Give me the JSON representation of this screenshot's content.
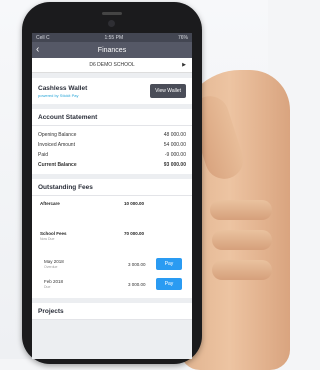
{
  "status_bar": {
    "carrier": "Cell C",
    "time": "1:55 PM",
    "battery": "76%"
  },
  "nav": {
    "title": "Finances"
  },
  "school": {
    "name": "D6 DEMO SCHOOL"
  },
  "wallet": {
    "title": "Cashless Wallet",
    "powered": "powered by Stickit Pay",
    "button": "View Wallet"
  },
  "statement": {
    "title": "Account Statement",
    "rows": [
      {
        "label": "Opening Balance",
        "value": "48 000.00"
      },
      {
        "label": "Invoiced Amount",
        "value": "54 000.00"
      },
      {
        "label": "Paid",
        "value": "-9 000.00"
      },
      {
        "label": "Current Balance",
        "value": "93 000.00"
      }
    ]
  },
  "fees": {
    "title": "Outstanding Fees",
    "items": [
      {
        "label": "Aftercare",
        "value": "10 000.00"
      },
      {
        "label": "School Fees",
        "sub": "Now Due",
        "value": "70 000.00"
      }
    ],
    "payments": [
      {
        "label": "May 2018",
        "sub": "Overdue",
        "value": "3 000.00",
        "button": "Pay"
      },
      {
        "label": "Feb 2018",
        "sub": "Due",
        "value": "3 000.00",
        "button": "Pay"
      }
    ]
  },
  "projects": {
    "title": "Projects"
  }
}
